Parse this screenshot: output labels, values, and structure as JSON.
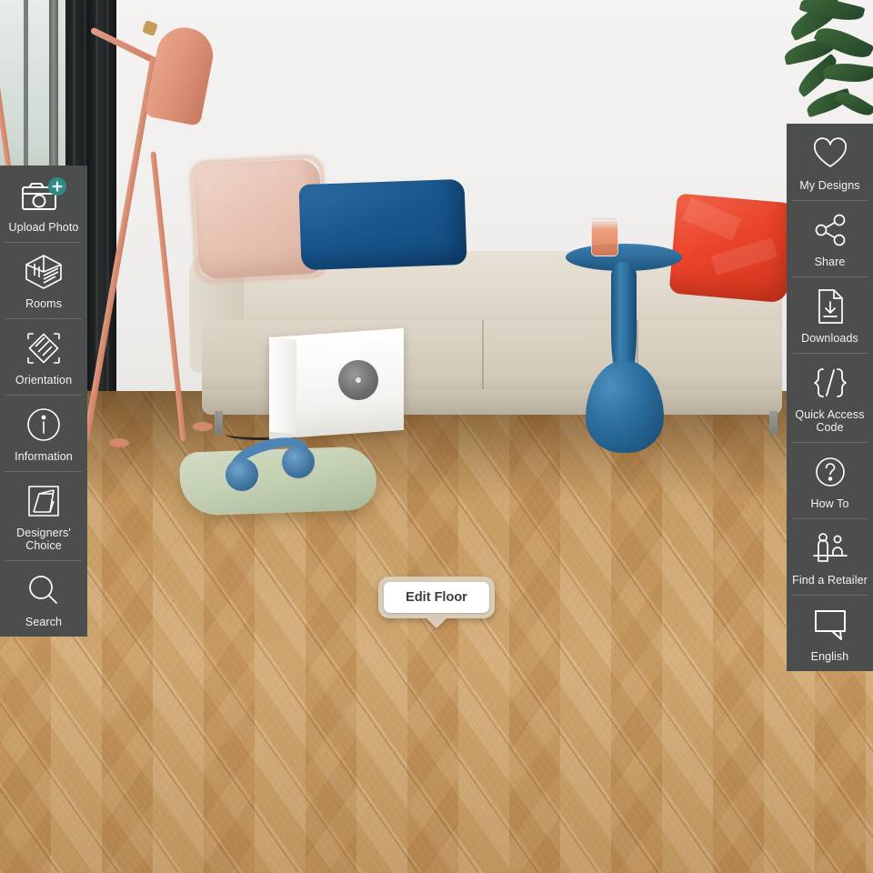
{
  "app": {
    "title": "Floor Visualizer",
    "scene_description": "Living room with beige sofa, pink and blue and red cushions, coral floor lamp, blue side table with juice glass, white record sleeve, green floor cushion with blue headphones, herringbone oak parquet floor",
    "sidebar_bg": "#4c4e4e",
    "accent_teal": "#2e8b86",
    "floor_wood": "#caa068"
  },
  "left_sidebar": {
    "items": [
      {
        "id": "upload-photo",
        "label": "Upload Photo",
        "icon": "camera-plus-icon"
      },
      {
        "id": "rooms",
        "label": "Rooms",
        "icon": "room-box-icon"
      },
      {
        "id": "orientation",
        "label": "Orientation",
        "icon": "orientation-icon"
      },
      {
        "id": "information",
        "label": "Information",
        "icon": "info-circle-icon"
      },
      {
        "id": "designers-choice",
        "label": "Designers'\nChoice",
        "icon": "designers-choice-icon"
      },
      {
        "id": "search",
        "label": "Search",
        "icon": "search-icon"
      }
    ]
  },
  "right_sidebar": {
    "items": [
      {
        "id": "my-designs",
        "label": "My Designs",
        "icon": "heart-icon"
      },
      {
        "id": "share",
        "label": "Share",
        "icon": "share-nodes-icon"
      },
      {
        "id": "downloads",
        "label": "Downloads",
        "icon": "download-document-icon"
      },
      {
        "id": "quick-access-code",
        "label": "Quick Access\nCode",
        "icon": "code-braces-icon"
      },
      {
        "id": "how-to",
        "label": "How To",
        "icon": "question-circle-icon"
      },
      {
        "id": "find-a-retailer",
        "label": "Find a Retailer",
        "icon": "retail-counter-icon"
      },
      {
        "id": "language",
        "label": "English",
        "icon": "speech-bubble-icon"
      }
    ]
  },
  "canvas": {
    "edit_floor": {
      "label": "Edit Floor",
      "frame_color": "#d9ccb9",
      "button_color": "#ffffff"
    }
  }
}
